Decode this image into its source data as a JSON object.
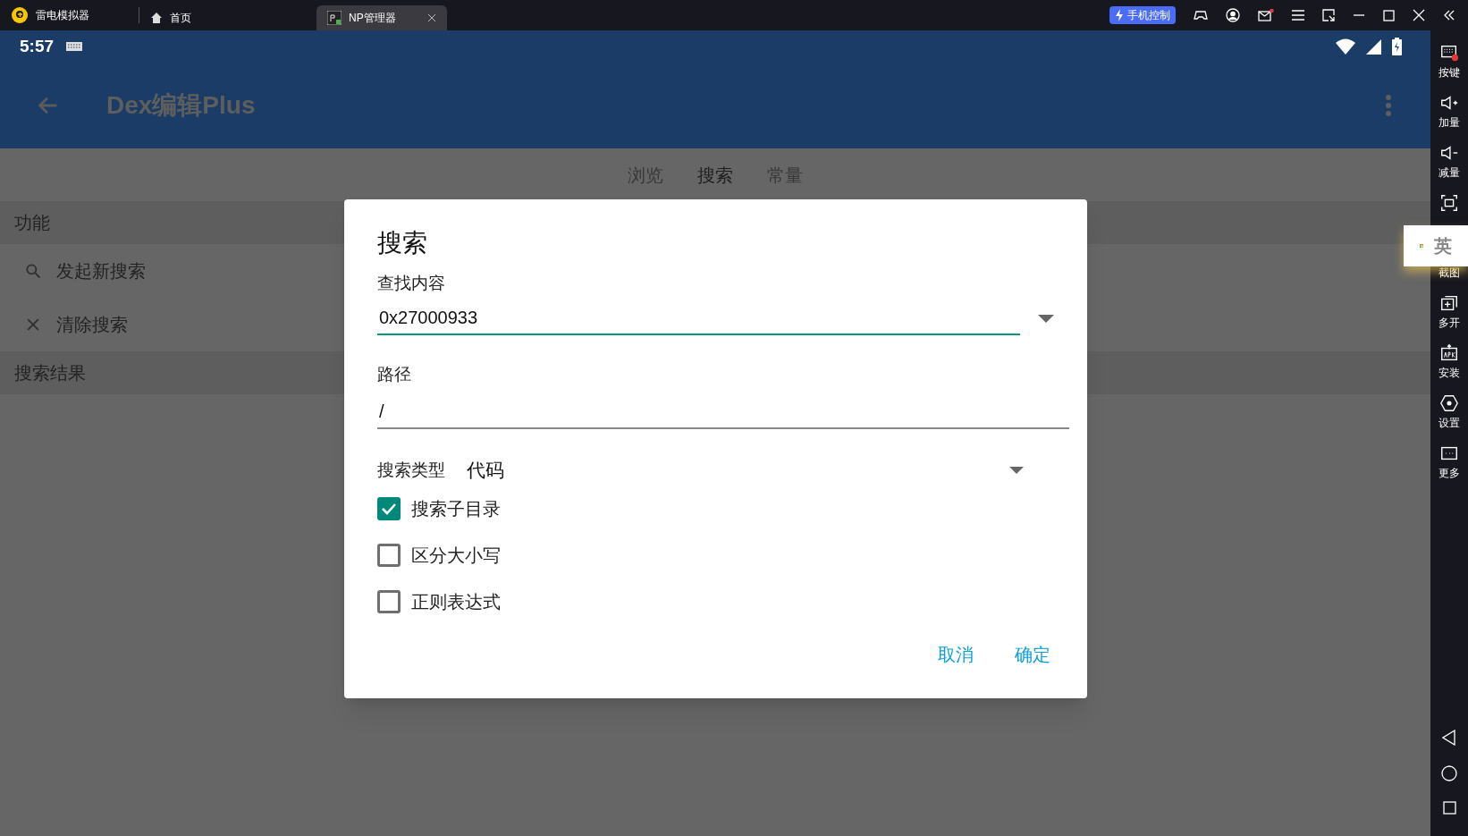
{
  "emulator": {
    "app_name": "雷电模拟器",
    "tabs": [
      {
        "label": "首页",
        "kind": "home",
        "selected": false
      },
      {
        "label": "NP管理器",
        "kind": "app",
        "selected": true
      }
    ],
    "control_button": "手机控制"
  },
  "sidebar": [
    {
      "kind": "keys",
      "label": "按键"
    },
    {
      "kind": "volume-up",
      "label": "加量"
    },
    {
      "kind": "volume-down",
      "label": "减量"
    },
    {
      "kind": "fullscreen"
    },
    {
      "kind": "covered",
      "label": "截图"
    },
    {
      "kind": "multi",
      "label": "多开"
    },
    {
      "kind": "apk",
      "label": "安装"
    },
    {
      "kind": "settings",
      "label": "设置"
    },
    {
      "kind": "more",
      "label": "更多"
    }
  ],
  "ime_popup": {
    "label": "英"
  },
  "status_bar": {
    "time": "5:57"
  },
  "app_bar": {
    "title": "Dex编辑Plus"
  },
  "tabs": [
    {
      "label": "浏览",
      "selected": false
    },
    {
      "label": "搜索",
      "selected": true
    },
    {
      "label": "常量",
      "selected": false
    }
  ],
  "sections": [
    {
      "header": "功能",
      "items": [
        {
          "kind": "search",
          "label": "发起新搜索"
        },
        {
          "kind": "clear",
          "label": "清除搜索"
        }
      ]
    },
    {
      "header": "搜索结果"
    }
  ],
  "dialog": {
    "title": "搜索",
    "find_label": "查找内容",
    "find_value": "0x27000933",
    "path_label": "路径",
    "path_value": "/",
    "type_label": "搜索类型",
    "type_value": "代码",
    "options": [
      {
        "label": "搜索子目录",
        "checked": true
      },
      {
        "label": "区分大小写",
        "checked": false
      },
      {
        "label": "正则表达式",
        "checked": false
      }
    ],
    "buttons": [
      "取消",
      "确定"
    ]
  }
}
